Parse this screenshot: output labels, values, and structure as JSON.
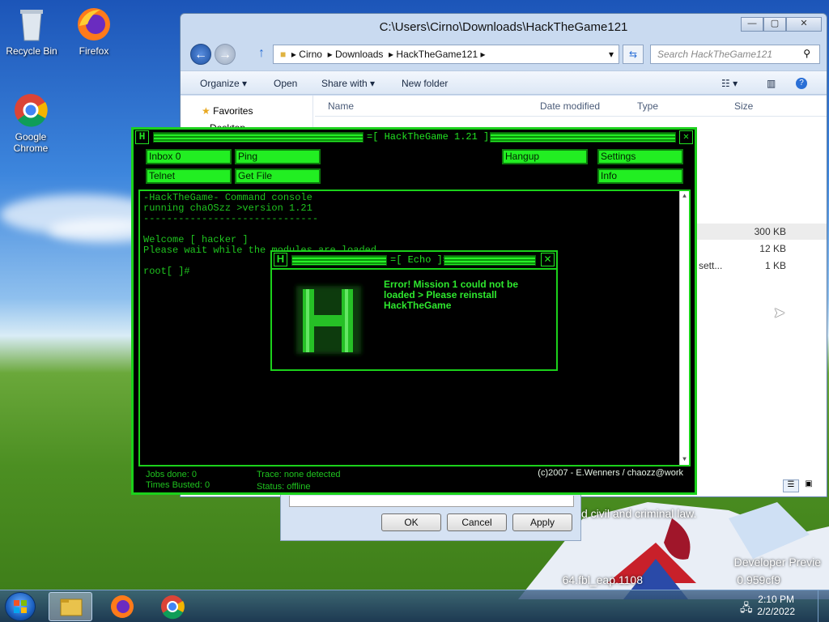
{
  "desktop": {
    "icons": [
      {
        "label": "Recycle Bin"
      },
      {
        "label": "Firefox"
      },
      {
        "label": "Google Chrome"
      }
    ],
    "watermark_line1": "Developer Previe",
    "watermark_line2": "64.fbl_eap.1108",
    "watermark_line3": "0.959cf9",
    "overlay_text": "d civil and criminal law."
  },
  "explorer": {
    "title": "C:\\Users\\Cirno\\Downloads\\HackTheGame121",
    "breadcrumb": [
      "Cirno",
      "Downloads",
      "HackTheGame121"
    ],
    "search_placeholder": "Search HackTheGame121",
    "toolbar": {
      "organize": "Organize ▾",
      "open": "Open",
      "share_with": "Share with ▾",
      "new_folder": "New folder"
    },
    "nav": {
      "favorites": "Favorites",
      "desktop": "Desktop"
    },
    "columns": {
      "name": "Name",
      "date_modified": "Date modified",
      "type": "Type",
      "size": "Size"
    },
    "rows": [
      {
        "name": "",
        "size": "300 KB"
      },
      {
        "name": "",
        "size": "12 KB"
      },
      {
        "name": "sett...",
        "size": "1 KB"
      }
    ]
  },
  "htg": {
    "title": "=[ HackTheGame 1.21 ]=",
    "buttons": {
      "inbox": "Inbox 0",
      "ping": "Ping",
      "hangup": "Hangup",
      "settings": "Settings",
      "telnet": "Telnet",
      "get_file": "Get File",
      "info": "Info"
    },
    "console": {
      "line1": "-HackTheGame- Command console",
      "line2": "running chaOSzz >version 1.21",
      "line3": "------------------------------",
      "line4": "",
      "line5": "Welcome [ hacker ]",
      "line6": "Please wait while the modules are loaded",
      "line7": "",
      "line8": "root[ ]#"
    },
    "status": {
      "jobs_done": "Jobs done: 0",
      "times_busted": "Times Busted: 0",
      "trace": "Trace: none detected",
      "status": "Status: offline",
      "copyright": "(c)2007 - E.Wenners / chaozz@work"
    }
  },
  "echo": {
    "title": "=[ Echo ]=",
    "message": "Error! Mission 1 could not be loaded > Please reinstall HackTheGame"
  },
  "properties": {
    "ok": "OK",
    "cancel": "Cancel",
    "apply": "Apply"
  },
  "taskbar": {
    "time": "2:10 PM",
    "date": "2/2/2022"
  },
  "colors": {
    "hacker_green": "#22e322",
    "dark_green": "#0c7b0c"
  }
}
